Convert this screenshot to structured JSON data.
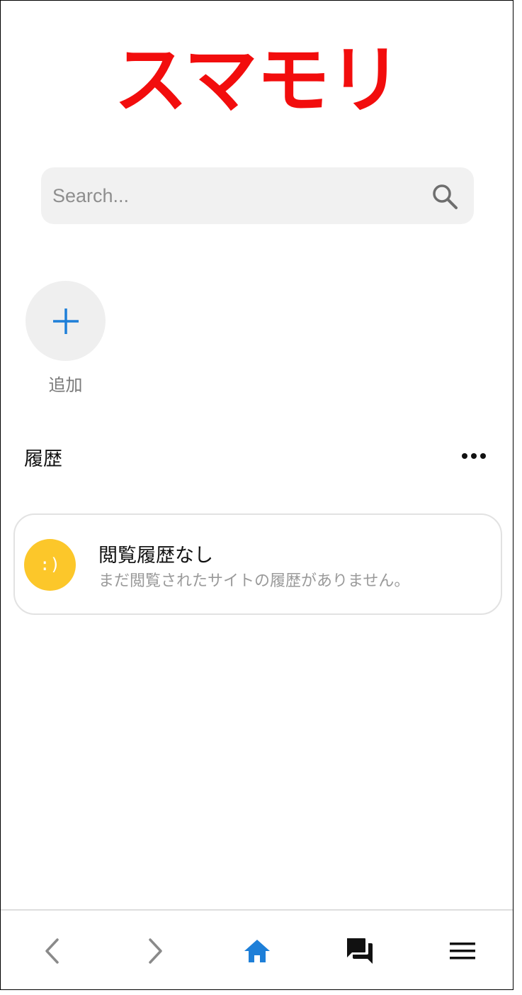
{
  "logo": {
    "text": "スマモリ",
    "color": "#f20d0d"
  },
  "search": {
    "placeholder": "Search...",
    "icon": "search-icon"
  },
  "quick_add": {
    "label": "追加",
    "icon": "plus-icon",
    "accent": "#1e7fd8"
  },
  "history": {
    "title": "履歴",
    "menu_icon": "more-horizontal-icon",
    "empty_state": {
      "icon_text": ":)",
      "icon_color": "#fcc72a",
      "title": "閲覧履歴なし",
      "message": "まだ閲覧されたサイトの履歴がありません。"
    }
  },
  "bottom_nav": {
    "items": [
      {
        "name": "back",
        "icon": "chevron-left-icon"
      },
      {
        "name": "forward",
        "icon": "chevron-right-icon"
      },
      {
        "name": "home",
        "icon": "home-icon",
        "active": true,
        "color": "#1e7fd8"
      },
      {
        "name": "chat",
        "icon": "chat-bubbles-icon"
      },
      {
        "name": "menu",
        "icon": "hamburger-menu-icon"
      }
    ]
  }
}
